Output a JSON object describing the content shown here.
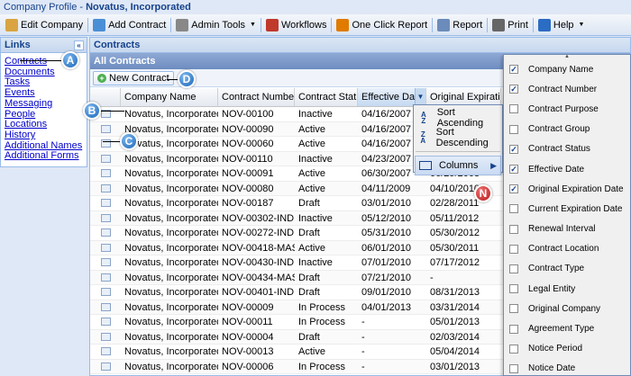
{
  "window": {
    "title_prefix": "Company Profile - ",
    "title_entity": "Novatus, Incorporated"
  },
  "toolbar": {
    "items": [
      {
        "label": "Edit Company",
        "icon": "edit-icon",
        "color": "#d9a441"
      },
      {
        "label": "Add Contract",
        "icon": "add-contract-icon",
        "color": "#4a8fd6"
      },
      {
        "label": "Admin Tools",
        "icon": "wrench-icon",
        "color": "#888888",
        "dropdown": true
      },
      {
        "label": "Workflows",
        "icon": "workflow-icon",
        "color": "#c0392b"
      },
      {
        "label": "One Click Report",
        "icon": "report-icon",
        "color": "#e07b00"
      },
      {
        "label": "Report",
        "icon": "document-icon",
        "color": "#6b8cba"
      },
      {
        "label": "Print",
        "icon": "printer-icon",
        "color": "#666666"
      },
      {
        "label": "Help",
        "icon": "help-icon",
        "color": "#2b6cc4",
        "dropdown": true
      }
    ]
  },
  "links": {
    "header": "Links",
    "items": [
      "Contracts",
      "Documents",
      "Tasks",
      "Events",
      "Messaging",
      "People",
      "Locations",
      "History",
      "Additional Names",
      "Additional Forms"
    ]
  },
  "main": {
    "header": "Contracts",
    "subheader": "All Contracts",
    "new_button": "New Contract"
  },
  "grid": {
    "columns": [
      "",
      "Company Name",
      "Contract Number",
      "Contract Status",
      "Effective Date",
      "Original Expiration Da"
    ],
    "rows": [
      [
        "Novatus, Incorporated",
        "NOV-00100",
        "Inactive",
        "04/16/2007",
        "04/15/2008"
      ],
      [
        "Novatus, Incorporated",
        "NOV-00090",
        "Active",
        "04/16/2007",
        "04/15/2008"
      ],
      [
        "Novatus, Incorporated",
        "NOV-00060",
        "Active",
        "04/16/2007",
        "04/15/2008"
      ],
      [
        "Novatus, Incorporated",
        "NOV-00110",
        "Inactive",
        "04/23/2007",
        "04/22/2008"
      ],
      [
        "Novatus, Incorporated",
        "NOV-00091",
        "Active",
        "06/30/2007",
        "06/29/2008"
      ],
      [
        "Novatus, Incorporated",
        "NOV-00080",
        "Active",
        "04/11/2009",
        "04/10/2010"
      ],
      [
        "Novatus, Incorporated",
        "NOV-00187",
        "Draft",
        "03/01/2010",
        "02/28/2011"
      ],
      [
        "Novatus, Incorporated",
        "NOV-00302-IND",
        "Inactive",
        "05/12/2010",
        "05/11/2012"
      ],
      [
        "Novatus, Incorporated",
        "NOV-00272-IND",
        "Draft",
        "05/31/2010",
        "05/30/2012"
      ],
      [
        "Novatus, Incorporated",
        "NOV-00418-MAS",
        "Active",
        "06/01/2010",
        "05/30/2011"
      ],
      [
        "Novatus, Incorporated",
        "NOV-00430-IND",
        "Inactive",
        "07/01/2010",
        "07/17/2012"
      ],
      [
        "Novatus, Incorporated",
        "NOV-00434-MAS",
        "Draft",
        "07/21/2010",
        "-"
      ],
      [
        "Novatus, Incorporated",
        "NOV-00401-IND",
        "Draft",
        "09/01/2010",
        "08/31/2013"
      ],
      [
        "Novatus, Incorporated",
        "NOV-00009",
        "In Process",
        "04/01/2013",
        "03/31/2014"
      ],
      [
        "Novatus, Incorporated",
        "NOV-00011",
        "In Process",
        "-",
        "05/01/2013"
      ],
      [
        "Novatus, Incorporated",
        "NOV-00004",
        "Draft",
        "-",
        "02/03/2014"
      ],
      [
        "Novatus, Incorporated",
        "NOV-00013",
        "Active",
        "-",
        "05/04/2014"
      ],
      [
        "Novatus, Incorporated",
        "NOV-00006",
        "In Process",
        "-",
        "03/01/2013"
      ]
    ]
  },
  "sort_menu": {
    "items": [
      "Sort Ascending",
      "Sort Descending",
      "Columns"
    ]
  },
  "columns_menu": {
    "items": [
      {
        "label": "Company Name",
        "checked": true
      },
      {
        "label": "Contract Number",
        "checked": true
      },
      {
        "label": "Contract Purpose",
        "checked": false
      },
      {
        "label": "Contract Group",
        "checked": false
      },
      {
        "label": "Contract Status",
        "checked": true
      },
      {
        "label": "Effective Date",
        "checked": true
      },
      {
        "label": "Original Expiration Date",
        "checked": true
      },
      {
        "label": "Current Expiration Date",
        "checked": false
      },
      {
        "label": "Renewal Interval",
        "checked": false
      },
      {
        "label": "Contract Location",
        "checked": false
      },
      {
        "label": "Contract Type",
        "checked": false
      },
      {
        "label": "Legal Entity",
        "checked": false
      },
      {
        "label": "Original Company",
        "checked": false
      },
      {
        "label": "Agreement Type",
        "checked": false
      },
      {
        "label": "Notice Period",
        "checked": false
      },
      {
        "label": "Notice Date",
        "checked": false
      }
    ]
  },
  "callouts": {
    "a": "A",
    "b": "B",
    "c": "C",
    "d": "D",
    "n": "N"
  }
}
